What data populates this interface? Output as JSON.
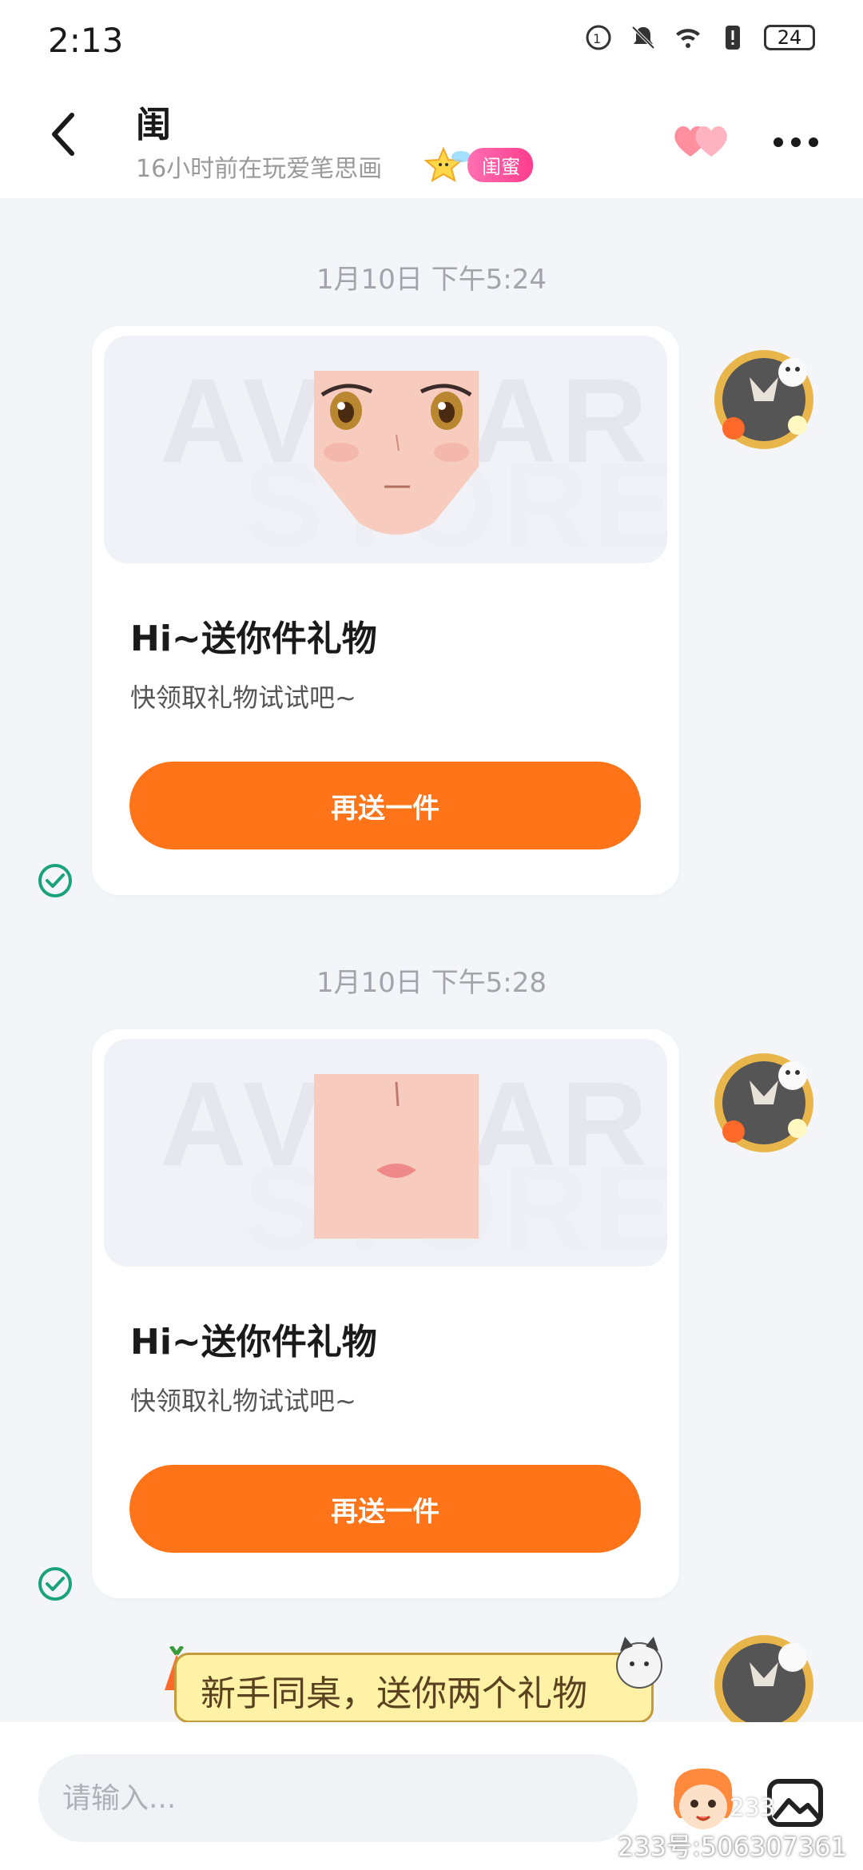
{
  "status_bar": {
    "time": "2:13",
    "battery": "24"
  },
  "header": {
    "name": "闺",
    "subtitle": "16小时前在玩爱笔思画",
    "badge": "闺蜜"
  },
  "messages": [
    {
      "timestamp": "1月10日 下午5:24",
      "watermark_top": "AVATAR",
      "watermark_bottom": "STORE",
      "title": "Hi~送你件礼物",
      "desc": "快领取礼物试试吧~",
      "button": "再送一件"
    },
    {
      "timestamp": "1月10日 下午5:28",
      "watermark_top": "AVATAR",
      "watermark_bottom": "STORE",
      "title": "Hi~送你件礼物",
      "desc": "快领取礼物试试吧~",
      "button": "再送一件"
    }
  ],
  "banner": {
    "text": "新手同桌，送你两个礼物"
  },
  "input": {
    "placeholder": "请输入..."
  },
  "footer": {
    "watermark": "233号:506307361",
    "logo": "233"
  },
  "colors": {
    "accent": "#ff7418",
    "badge": "#ff3d8f",
    "check": "#1aa37a"
  },
  "icons": [
    "back-icon",
    "hearts-icon",
    "more-icon",
    "check-icon",
    "emoji-icon",
    "image-icon"
  ]
}
